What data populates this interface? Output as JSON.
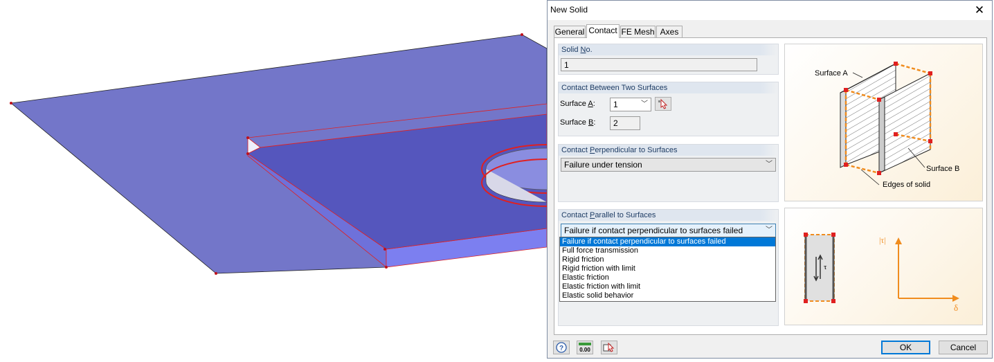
{
  "dialog": {
    "title": "New Solid",
    "tabs": [
      "General",
      "Contact",
      "FE Mesh",
      "Axes"
    ],
    "active_tab": "Contact"
  },
  "solid_no": {
    "label_pre": "Solid ",
    "label_u": "N",
    "label_post": "o.",
    "value": "1"
  },
  "contact_between": {
    "header": "Contact Between Two Surfaces",
    "surface_a": {
      "label_pre": "Surface ",
      "label_u": "A",
      "label_post": ":",
      "value": "1"
    },
    "surface_b": {
      "label_pre": "Surface ",
      "label_u": "B",
      "label_post": ":",
      "value": "2"
    }
  },
  "contact_perpendicular": {
    "header_pre": "Contact ",
    "header_u": "P",
    "header_post": "erpendicular to Surfaces",
    "value": "Failure under tension"
  },
  "contact_parallel": {
    "header_pre": "Contact ",
    "header_u": "P",
    "header_post": "arallel to Surfaces",
    "value": "Failure if contact perpendicular to surfaces failed",
    "options": [
      "Failure if contact perpendicular to surfaces failed",
      "Full force transmission",
      "Rigid friction",
      "Rigid friction with limit",
      "Elastic friction",
      "Elastic friction with limit",
      "Elastic solid behavior"
    ],
    "selected_index": 0
  },
  "illustration": {
    "surface_a": "Surface A",
    "surface_b": "Surface B",
    "edges": "Edges of solid",
    "tau_axis": "|τ|",
    "delta_axis": "δ",
    "tau": "τ"
  },
  "footer": {
    "ok": "OK",
    "cancel": "Cancel",
    "zero_value": "0.00"
  },
  "colors": {
    "accent": "#0078d7",
    "orange": "#f08c1e",
    "plate": "#7376c9",
    "plate_dark": "#5556bd",
    "edge_red": "#e02020"
  }
}
